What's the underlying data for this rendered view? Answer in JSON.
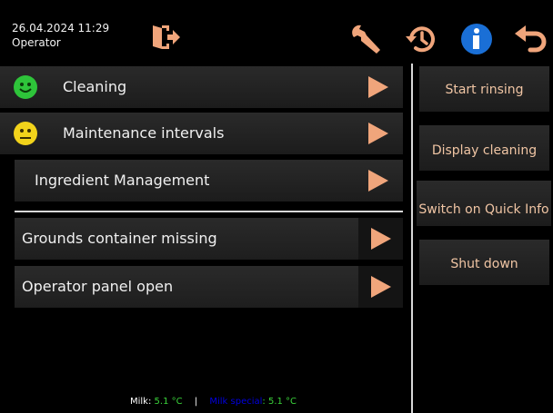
{
  "header": {
    "datetime": "26.04.2024 11:29",
    "role": "Operator",
    "icons": [
      "logout-icon",
      "wrench-icon",
      "history-icon",
      "info-icon",
      "back-icon"
    ]
  },
  "menu": {
    "cleaning": "Cleaning",
    "maintenance": "Maintenance intervals",
    "ingredients": "Ingredient Management"
  },
  "messages": {
    "grounds": "Grounds container missing",
    "panel": "Operator panel open"
  },
  "actions": {
    "start_rinsing": "Start rinsing",
    "display_cleaning": "Display cleaning",
    "quick_info": "Switch on Quick Info",
    "shut_down": "Shut down"
  },
  "footer": {
    "milk_label": "Milk:",
    "milk_value": "5.1 °C",
    "separator": "|",
    "milk_special_label": "Milk special",
    "milk_special_value": ": 5.1 °C"
  },
  "colors": {
    "accent_arrow": "#f0a57b",
    "button_text": "#f0c5a4",
    "status_ok": "#2ec43a",
    "status_warn": "#f2d31b",
    "info_blue": "#1a6fd6",
    "temp_green": "#3ad23a",
    "milk_special_blue": "#0000e0"
  }
}
